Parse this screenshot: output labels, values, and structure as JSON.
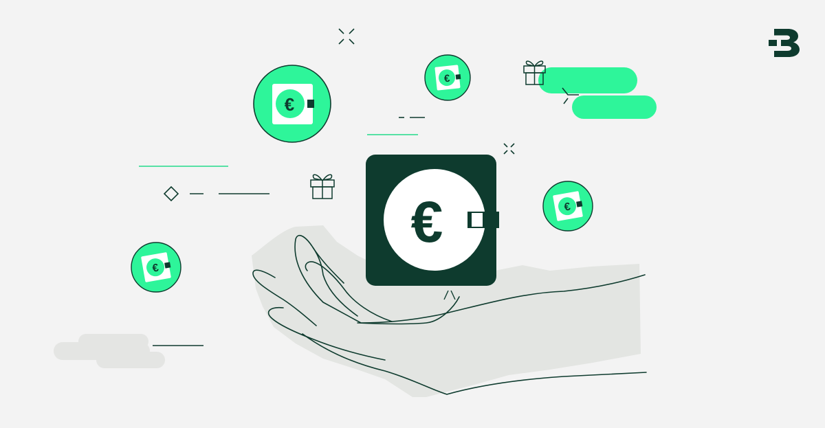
{
  "brand": {
    "logo_icon": "bitpanda-b-logo-icon"
  },
  "colors": {
    "background": "#f3f3f3",
    "dark_green": "#0e3b2e",
    "accent_green": "#2ef59a",
    "line_green": "#22d98a",
    "hand_fill": "#e3e5e2",
    "cloud_grey": "#e4e5e3",
    "white": "#ffffff"
  },
  "illustration": {
    "main_icon": "euro-wallet-icon",
    "currency_symbol": "€",
    "coins": [
      {
        "icon": "euro-coin-icon",
        "size": "large"
      },
      {
        "icon": "euro-coin-icon",
        "size": "medium"
      },
      {
        "icon": "euro-coin-icon",
        "size": "medium"
      },
      {
        "icon": "euro-coin-icon",
        "size": "medium"
      }
    ],
    "decorations": [
      "gift-icon",
      "gift-icon",
      "sparkle-icon",
      "sparkle-icon",
      "diamond-icon",
      "cloud-shape",
      "cloud-shape"
    ]
  }
}
